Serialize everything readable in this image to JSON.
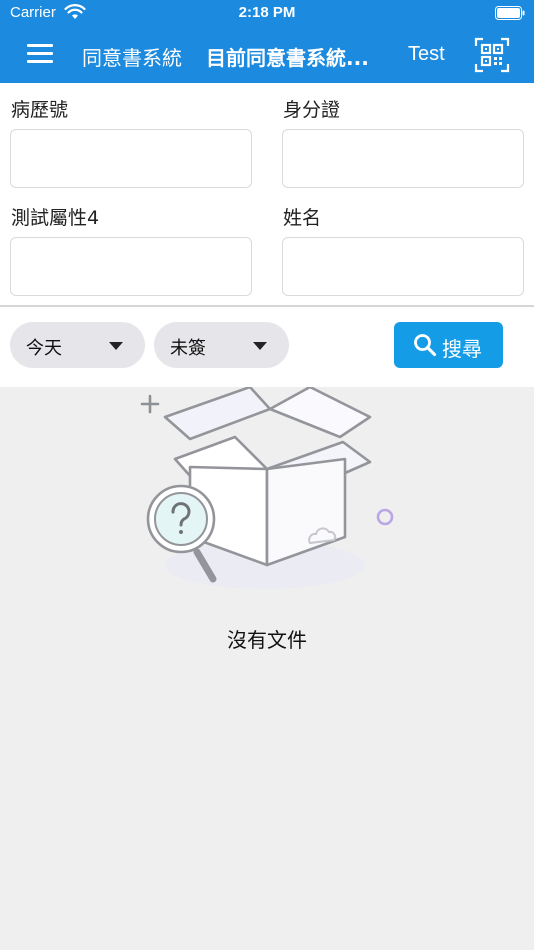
{
  "status_bar": {
    "carrier": "Carrier",
    "time": "2:18 PM"
  },
  "header": {
    "system_title": "同意書系統",
    "current_title": "目前同意書系統...",
    "user": "Test"
  },
  "form": {
    "medical_record_no_label": "病歷號",
    "id_number_label": "身分證",
    "test_attribute_label": "測試屬性4",
    "name_label": "姓名",
    "medical_record_no_value": "",
    "id_number_value": "",
    "test_attribute_value": "",
    "name_value": ""
  },
  "filters": {
    "date_selected": "今天",
    "sign_status_selected": "未簽",
    "search_label": "搜尋"
  },
  "empty_state": {
    "message": "沒有文件"
  },
  "colors": {
    "header_bg": "#1c8bdf",
    "search_button": "#159ce6",
    "content_bg": "#efefef"
  },
  "icons": [
    "wifi-icon",
    "battery-icon",
    "hamburger-menu-icon",
    "qr-code-scan-icon",
    "search-icon",
    "caret-down-icon",
    "empty-box-icon"
  ]
}
